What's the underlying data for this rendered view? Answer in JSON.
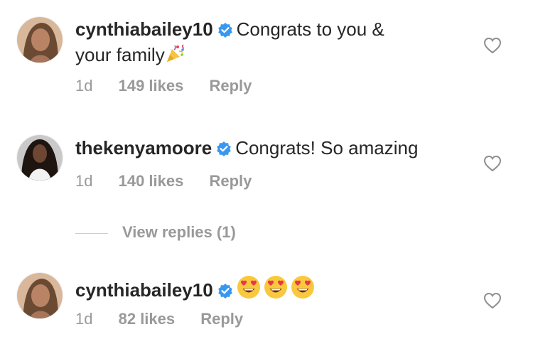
{
  "comments": [
    {
      "username": "cynthiabailey10",
      "text": "Congrats to you & your family",
      "text_line1": "Congrats to you &",
      "text_line2": "your family",
      "time": "1d",
      "likes": "149 likes",
      "reply": "Reply",
      "verified": true,
      "trailing_icon": "party-popper-emoji"
    },
    {
      "username": "thekenyamoore",
      "text": "Congrats! So amazing",
      "time": "1d",
      "likes": "140 likes",
      "reply": "Reply",
      "verified": true
    },
    {
      "username": "cynthiabailey10",
      "emojis": [
        "heart-eyes-emoji",
        "heart-eyes-emoji",
        "heart-eyes-emoji"
      ],
      "time": "1d",
      "likes": "82 likes",
      "reply": "Reply",
      "verified": true
    }
  ],
  "view_replies": {
    "label": "View replies (1)"
  },
  "colors": {
    "text": "#262626",
    "secondary": "#999999",
    "verified_badge": "#3897f0",
    "heart_outline": "#8e8e8e"
  }
}
